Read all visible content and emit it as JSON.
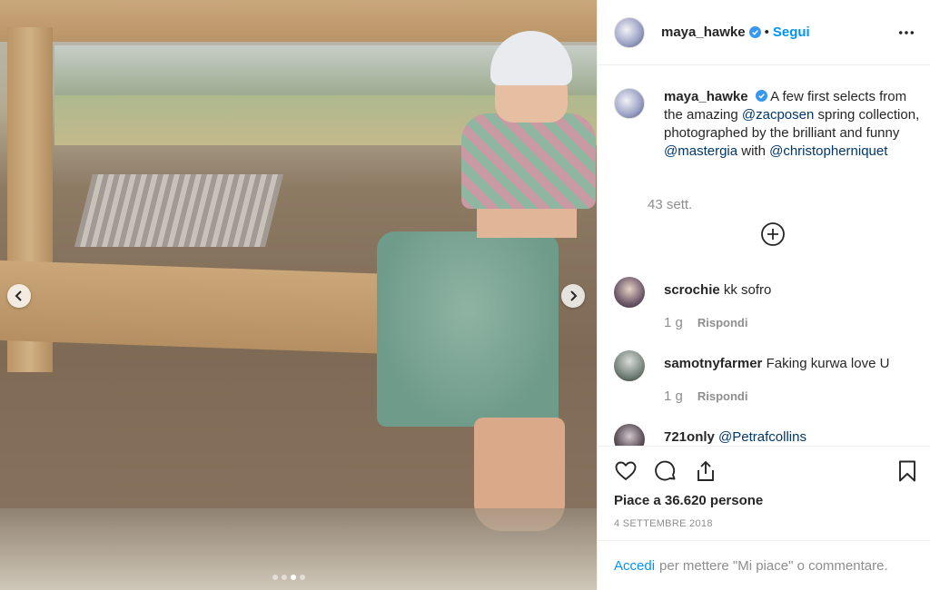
{
  "post": {
    "image_alt": "",
    "carousel_dots": 4,
    "carousel_active": 2
  },
  "header": {
    "username": "maya_hawke",
    "separator": "•",
    "follow_label": "Segui"
  },
  "caption": {
    "username": "maya_hawke",
    "text_1": "A few first selects from the amazing ",
    "mention_1": "@zacposen",
    "text_2": " spring collection, photographed by the brilliant and funny ",
    "mention_2": "@mastergia",
    "text_3": " with ",
    "mention_3": "@christopherniquet",
    "time": "43 sett."
  },
  "comments": [
    {
      "username": "scrochie",
      "text": "kk sofro",
      "time": "1 g",
      "reply_label": "Rispondi"
    },
    {
      "username": "samotnyfarmer",
      "text": "Faking kurwa love U",
      "time": "1 g",
      "reply_label": "Rispondi"
    },
    {
      "username": "721only",
      "mention": "@Petrafcollins"
    }
  ],
  "actions": {
    "likes_label": "Piace a 36.620 persone",
    "date": "4 SETTEMBRE 2018"
  },
  "login_bar": {
    "login_label": "Accedi",
    "rest": "per mettere \"Mi piace\" o commentare."
  },
  "colors": {
    "accent": "#0095f6",
    "mention": "#00376b",
    "muted": "#8e8e8e",
    "verified": "#3897f0"
  }
}
